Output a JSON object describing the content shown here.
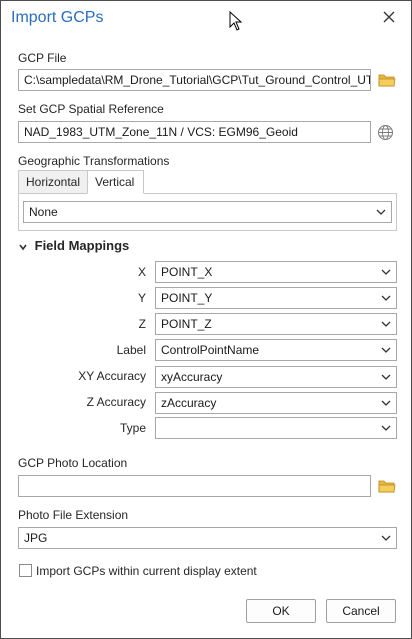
{
  "window": {
    "title": "Import GCPs",
    "close_icon": "close-icon"
  },
  "gcp_file": {
    "label": "GCP File",
    "value": "C:\\sampledata\\RM_Drone_Tutorial\\GCP\\Tut_Ground_Control_UTM",
    "icon": "folder-icon"
  },
  "spatial_reference": {
    "label": "Set GCP Spatial Reference",
    "value": "NAD_1983_UTM_Zone_11N / VCS: EGM96_Geoid",
    "icon": "globe-icon"
  },
  "transformations": {
    "label": "Geographic Transformations",
    "tabs": [
      "Horizontal",
      "Vertical"
    ],
    "active_tab": "Vertical",
    "value": "None"
  },
  "field_mappings": {
    "title": "Field Mappings",
    "rows": [
      {
        "label": "X",
        "value": "POINT_X"
      },
      {
        "label": "Y",
        "value": "POINT_Y"
      },
      {
        "label": "Z",
        "value": "POINT_Z"
      },
      {
        "label": "Label",
        "value": "ControlPointName"
      },
      {
        "label": "XY Accuracy",
        "value": "xyAccuracy"
      },
      {
        "label": "Z Accuracy",
        "value": "zAccuracy"
      },
      {
        "label": "Type",
        "value": ""
      }
    ]
  },
  "photo_location": {
    "label": "GCP Photo Location",
    "value": "",
    "icon": "folder-icon"
  },
  "photo_extension": {
    "label": "Photo File Extension",
    "value": "JPG"
  },
  "import_extent": {
    "label": "Import GCPs within current display extent",
    "checked": false
  },
  "buttons": {
    "ok": "OK",
    "cancel": "Cancel"
  },
  "colors": {
    "title": "#2a6ebb",
    "folder": "#e8b838",
    "border": "#a8a8a8"
  }
}
